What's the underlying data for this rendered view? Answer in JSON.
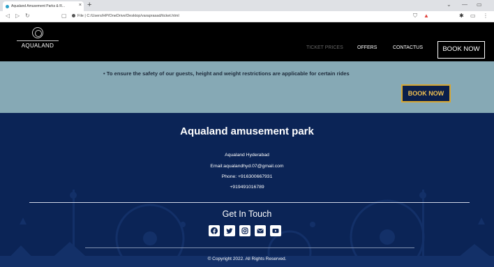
{
  "browser": {
    "tab_title": "Aqualand Amusement Parks & R...",
    "tab_close": "×",
    "new_tab": "+",
    "url": "File | C:/Users/HP/OneDrive/Desktop/varaprasad/ticket.html"
  },
  "nav": {
    "logo_text": "AQUALAND",
    "links": [
      "TICKET PRICES",
      "OFFERS",
      "CONTACTUS"
    ],
    "book_button": "BOOK NOW"
  },
  "info": {
    "bullet": "• To ensure the safety of our guests, height and weight restrictions are applicable for certain rides",
    "book_button": "BOOK NOW"
  },
  "footer": {
    "title": "Aqualand amusement park",
    "location": "Aqualand Hyderabad",
    "email": "Email:aqualandhyd.07@gmail.com",
    "phone1": "Phone: +916300667931",
    "phone2": "+919491016789",
    "get_in_touch": "Get In Touch",
    "socials": [
      "facebook-icon",
      "twitter-icon",
      "instagram-icon",
      "envelope-icon",
      "youtube-icon"
    ],
    "copyright": "© Copyright 2022. All Rights Reserved."
  },
  "colors": {
    "nav_bg": "#000000",
    "info_bg": "#86a9b5",
    "footer_bg": "#0b2456",
    "accent_gold": "#d6a632"
  }
}
